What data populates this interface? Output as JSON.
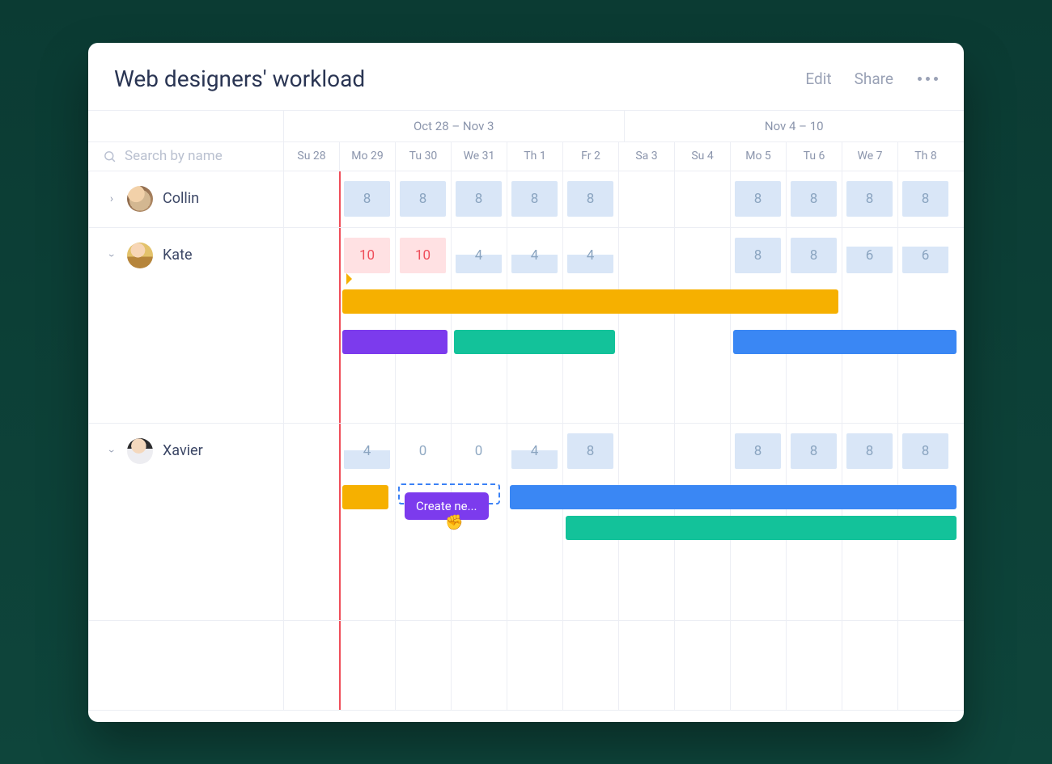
{
  "header": {
    "title": "Web designers' workload",
    "edit": "Edit",
    "share": "Share"
  },
  "search": {
    "placeholder": "Search by name"
  },
  "weeks": [
    "Oct 28 – Nov 3",
    "Nov 4 – 10"
  ],
  "days": [
    "Su 28",
    "Mo 29",
    "Tu 30",
    "We 31",
    "Th 1",
    "Fr 2",
    "Sa 3",
    "Su 4",
    "Mo 5",
    "Tu 6",
    "We 7",
    "Th 8"
  ],
  "people": [
    {
      "name": "Collin",
      "expanded": false,
      "hours": [
        "",
        "8",
        "8",
        "8",
        "8",
        "8",
        "",
        "",
        "8",
        "8",
        "8",
        "8"
      ]
    },
    {
      "name": "Kate",
      "expanded": true,
      "hours": [
        "",
        "10",
        "10",
        "4",
        "4",
        "4",
        "",
        "",
        "8",
        "8",
        "6",
        "6"
      ]
    },
    {
      "name": "Xavier",
      "expanded": true,
      "hours": [
        "",
        "4",
        "0",
        "0",
        "4",
        "8",
        "",
        "",
        "8",
        "8",
        "8",
        "8"
      ]
    }
  ],
  "createLabel": "Create ne...",
  "colors": {
    "yellow": "#f6b000",
    "purple": "#7c3bed",
    "teal": "#13c29a",
    "blue": "#3a87f4"
  },
  "chart_data": {
    "type": "table",
    "title": "Web designers' workload",
    "columns": [
      "Su 28",
      "Mo 29",
      "Tu 30",
      "We 31",
      "Th 1",
      "Fr 2",
      "Sa 3",
      "Su 4",
      "Mo 5",
      "Tu 6",
      "We 7",
      "Th 8"
    ],
    "rows": [
      {
        "name": "Collin",
        "values": [
          null,
          8,
          8,
          8,
          8,
          8,
          null,
          null,
          8,
          8,
          8,
          8
        ]
      },
      {
        "name": "Kate",
        "values": [
          null,
          10,
          10,
          4,
          4,
          4,
          null,
          null,
          8,
          8,
          6,
          6
        ]
      },
      {
        "name": "Xavier",
        "values": [
          null,
          4,
          0,
          0,
          4,
          8,
          null,
          null,
          8,
          8,
          8,
          8
        ]
      }
    ],
    "tasks": [
      {
        "person": "Kate",
        "color": "yellow",
        "start": "Mo 29",
        "end": "Tu 6"
      },
      {
        "person": "Kate",
        "color": "purple",
        "start": "Mo 29",
        "end": "Tu 30"
      },
      {
        "person": "Kate",
        "color": "teal",
        "start": "We 31",
        "end": "Fr 2"
      },
      {
        "person": "Kate",
        "color": "blue",
        "start": "Mo 5",
        "end": "Th 8+"
      },
      {
        "person": "Xavier",
        "color": "yellow",
        "start": "Mo 29",
        "end": "Mo 29"
      },
      {
        "person": "Xavier",
        "color": "blue",
        "start": "Th 1",
        "end": "Th 8+"
      },
      {
        "person": "Xavier",
        "color": "teal",
        "start": "Fr 2",
        "end": "Th 8+"
      }
    ]
  }
}
